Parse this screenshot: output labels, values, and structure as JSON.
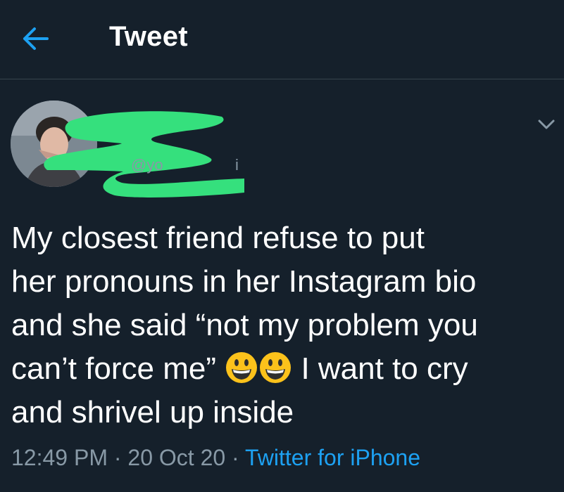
{
  "header": {
    "back_icon": "arrow-left-icon",
    "title": "Tweet"
  },
  "author": {
    "avatar_icon": "profile-photo",
    "redaction_color": "#35e07d",
    "handle_fragment": "@yo",
    "handle_tail": "i"
  },
  "menu_icon": "chevron-down-icon",
  "tweet": {
    "lines": [
      "My closest friend refuse to put",
      "her pronouns in her Instagram bio",
      "and she said “not my problem you",
      "can’t force me”",
      "I want to cry",
      "and shrivel up inside"
    ],
    "emoji": [
      "grinning-face-emoji",
      "grinning-face-emoji"
    ]
  },
  "meta": {
    "time": "12:49 PM",
    "separator": " · ",
    "date": "20 Oct 20",
    "source": "Twitter for iPhone"
  },
  "colors": {
    "background": "#15202b",
    "text": "#ffffff",
    "secondary": "#8899a6",
    "accent": "#1da1f2",
    "divider": "#38444d"
  }
}
